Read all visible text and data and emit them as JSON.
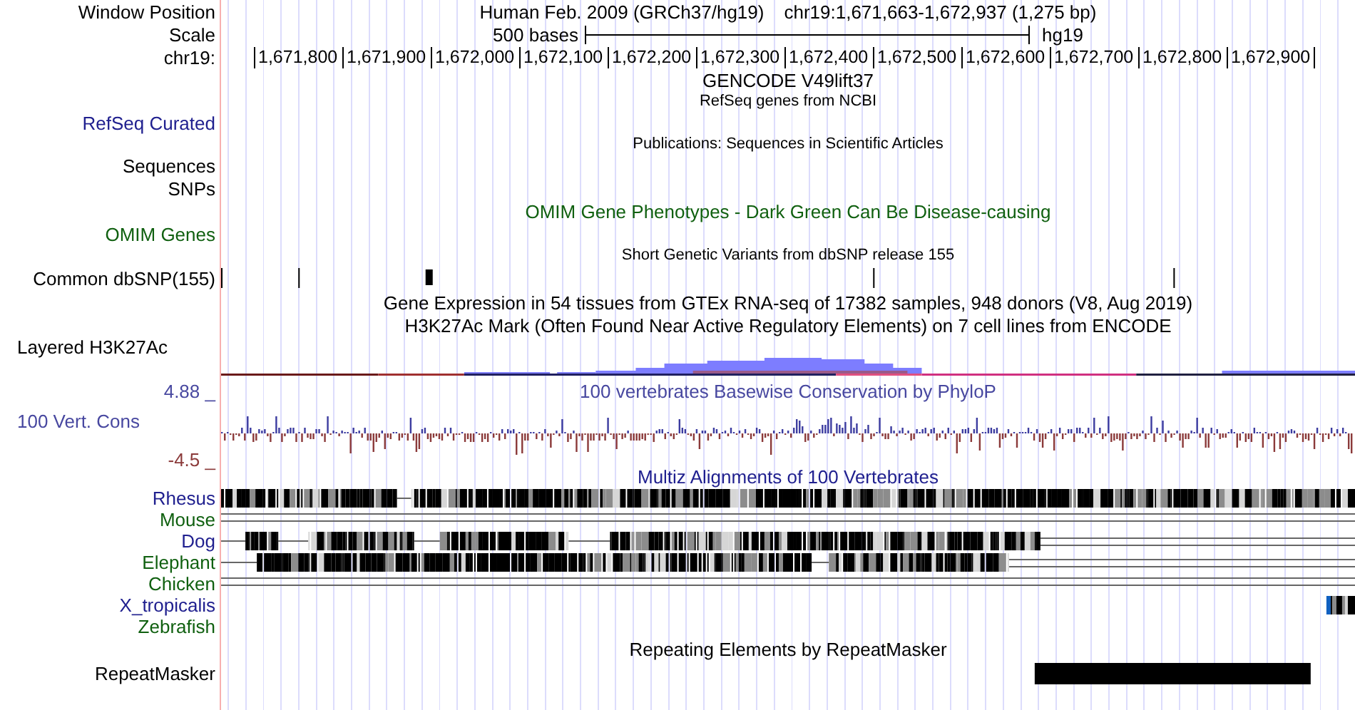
{
  "header": {
    "window_position_label": "Window Position",
    "assembly": "Human Feb. 2009 (GRCh37/hg19)",
    "position": "chr19:1,671,663-1,672,937 (1,275 bp)",
    "scale_label": "Scale",
    "scale_length": "500 bases",
    "scale_assembly": "hg19",
    "chrom_label": "chr19:",
    "ticks": [
      "1,671,800",
      "1,671,900",
      "1,672,000",
      "1,672,100",
      "1,672,200",
      "1,672,300",
      "1,672,400",
      "1,672,500",
      "1,672,600",
      "1,672,700",
      "1,672,800",
      "1,672,900"
    ]
  },
  "tracks": [
    {
      "kind": "title",
      "title": "GENCODE V49lift37",
      "small": false,
      "color": "#000000"
    },
    {
      "kind": "title",
      "title": "RefSeq genes from NCBI",
      "small": true,
      "color": "#000000"
    },
    {
      "kind": "label",
      "label": "RefSeq Curated",
      "color": "#20208f"
    },
    {
      "kind": "title",
      "title": "Publications: Sequences in Scientific Articles",
      "small": true,
      "color": "#000000"
    },
    {
      "kind": "label",
      "label": "Sequences",
      "color": "#000000"
    },
    {
      "kind": "label",
      "label": "SNPs",
      "color": "#000000"
    },
    {
      "kind": "title",
      "title": "OMIM Gene Phenotypes - Dark Green Can Be Disease-causing",
      "small": false,
      "color": "#106010"
    },
    {
      "kind": "label",
      "label": "OMIM Genes",
      "color": "#106010"
    },
    {
      "kind": "title",
      "title": "Short Genetic Variants from dbSNP release 155",
      "small": true,
      "color": "#000000"
    },
    {
      "kind": "snp",
      "label": "Common dbSNP(155)",
      "color": "#000000"
    },
    {
      "kind": "title",
      "title": "Gene Expression in 54 tissues from GTEx RNA-seq of 17382 samples, 948 donors (V8, Aug 2019)",
      "small": false,
      "color": "#000000"
    },
    {
      "kind": "title",
      "title": "H3K27Ac Mark (Often Found Near Active Regulatory Elements) on 7 cell lines from ENCODE",
      "small": false,
      "color": "#000000"
    },
    {
      "kind": "layered",
      "label": "Layered H3K27Ac",
      "color": "#000000"
    },
    {
      "kind": "title",
      "label": "4.88 _",
      "title": "100 vertebrates Basewise Conservation by PhyloP",
      "small": false,
      "color": "#4848a0"
    },
    {
      "kind": "wiggle",
      "label": "100 Vert. Cons",
      "min_label": "-4.5 _",
      "color": "#4848a0"
    },
    {
      "kind": "title",
      "title": "Multiz Alignments of 100 Vertebrates",
      "small": false,
      "color": "#20208f"
    },
    {
      "kind": "multiz-full",
      "label": "Rhesus",
      "color": "#20208f"
    },
    {
      "kind": "multiz-lines",
      "label": "Mouse",
      "color": "#106010"
    },
    {
      "kind": "multiz-partial",
      "label": "Dog",
      "color": "#20208f"
    },
    {
      "kind": "multiz-mostly",
      "label": "Elephant",
      "color": "#106010"
    },
    {
      "kind": "multiz-lines",
      "label": "Chicken",
      "color": "#106010"
    },
    {
      "kind": "multiz-edge",
      "label": "X_tropicalis",
      "color": "#20208f"
    },
    {
      "kind": "multiz-none",
      "label": "Zebrafish",
      "color": "#106010"
    },
    {
      "kind": "title",
      "title": "Repeating Elements by RepeatMasker",
      "small": false,
      "color": "#000000"
    },
    {
      "kind": "repeat",
      "label": "RepeatMasker",
      "color": "#000000"
    }
  ]
}
